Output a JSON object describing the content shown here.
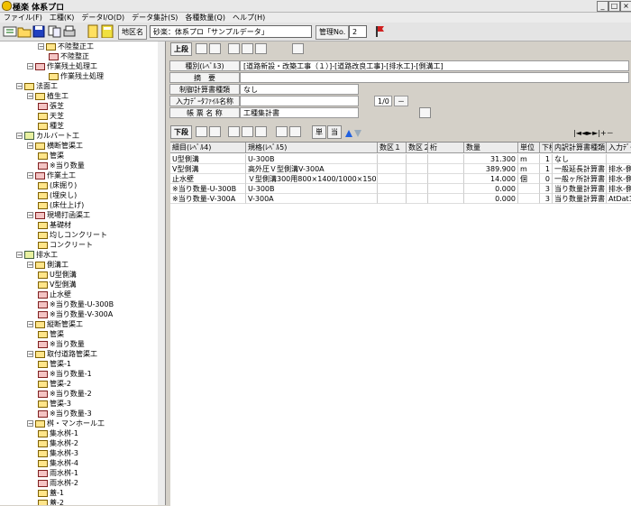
{
  "window": {
    "title": "極楽 体系プロ"
  },
  "menu": [
    "ファイル(F)",
    "工種(K)",
    "データI/O(D)",
    "データ集計(S)",
    "各種数量(Q)",
    "ヘルプ(H)"
  ],
  "toolbar": {
    "area_label": "地区名",
    "area_value": "砂楽：体系プロ「サンプルデータ」",
    "manage_label": "管理No.",
    "manage_value": "2"
  },
  "upper": {
    "title": "上段",
    "type_label": "種別(ﾚﾍﾞﾙ3)",
    "type_value": "[道路新設・改築工事（１）]-[道路改良工事]-[排水工]-[側溝工]",
    "summary_label": "摘　要",
    "summary_value": "",
    "control_label": "制御計算書種類",
    "control_value": "なし",
    "input_file_label": "入力ﾃﾞｰﾀﾌｧｲﾙ名称",
    "input_file_value": "1/0",
    "input_file_dash": "－",
    "book_label": "帳 票 名 称",
    "book_value": "工種集計書"
  },
  "lower": {
    "title": "下段",
    "single_label": "単",
    "per_label": "当",
    "nav": [
      "|◄",
      "◄",
      "►",
      "►|",
      "+",
      "－"
    ]
  },
  "grid": {
    "columns": [
      "細目(ﾚﾍﾞﾙ4)",
      "規格(ﾚﾍﾞﾙ5)",
      "数区１",
      "数区２",
      "桁",
      "数量",
      "単位",
      "下桁",
      "内訳計算書種類",
      "入力ﾃﾞｰﾀ"
    ],
    "rows": [
      [
        "U型側溝",
        "U-300B",
        "",
        "",
        "",
        "31.300",
        "m",
        "1",
        "なし",
        ""
      ],
      [
        "V型側溝",
        "高外圧Ｖ型側溝V-300A",
        "",
        "",
        "",
        "389.900",
        "m",
        "1",
        "一般延長計算書（m）",
        "排水-側溝"
      ],
      [
        "止水壁",
        "Ｖ型側溝300用800×1400/1000×150",
        "",
        "",
        "",
        "14.000",
        "個",
        "0",
        "一般ヶ所計算書（ヶ所）",
        "排水-側溝"
      ],
      [
        "※当り数量-U-300B",
        "U-300B",
        "",
        "",
        "",
        "0.000",
        "",
        "3",
        "当り数量計算書",
        "排水-側溝"
      ],
      [
        "※当り数量-V-300A",
        "V-300A",
        "",
        "",
        "",
        "0.000",
        "",
        "3",
        "当り数量計算書",
        "AtDat1.E"
      ]
    ]
  },
  "tree": [
    {
      "label": "不陸整正工",
      "depth": 2,
      "type": "folder",
      "exp": "−"
    },
    {
      "label": "不陸整正",
      "depth": 3,
      "type": "pfolder"
    },
    {
      "label": "作業残土処理工",
      "depth": 1,
      "type": "pfolder",
      "exp": "−"
    },
    {
      "label": "作業残土処理",
      "depth": 3,
      "type": "folder"
    },
    {
      "label": "法面工",
      "depth": 0,
      "type": "folder",
      "exp": "−"
    },
    {
      "label": "植生工",
      "depth": 1,
      "type": "folder",
      "exp": "−"
    },
    {
      "label": "張芝",
      "depth": 2,
      "type": "pfolder"
    },
    {
      "label": "天芝",
      "depth": 2,
      "type": "folder"
    },
    {
      "label": "種芝",
      "depth": 2,
      "type": "folder"
    },
    {
      "label": "カルバート工",
      "depth": 0,
      "type": "dfolder",
      "exp": "−"
    },
    {
      "label": "横断管渠工",
      "depth": 1,
      "type": "folder",
      "exp": "−"
    },
    {
      "label": "管渠",
      "depth": 2,
      "type": "folder"
    },
    {
      "label": "※当り数量",
      "depth": 2,
      "type": "pfolder"
    },
    {
      "label": "作業土工",
      "depth": 1,
      "type": "pfolder",
      "exp": "−"
    },
    {
      "label": "(床掘り)",
      "depth": 2,
      "type": "folder"
    },
    {
      "label": "(埋戻し)",
      "depth": 2,
      "type": "folder"
    },
    {
      "label": "(床仕上げ)",
      "depth": 2,
      "type": "folder"
    },
    {
      "label": "現場打函渠工",
      "depth": 1,
      "type": "pfolder",
      "exp": "−"
    },
    {
      "label": "基礎材",
      "depth": 2,
      "type": "folder"
    },
    {
      "label": "均しコンクリート",
      "depth": 2,
      "type": "folder"
    },
    {
      "label": "コンクリート",
      "depth": 2,
      "type": "folder"
    },
    {
      "label": "排水工",
      "depth": 0,
      "type": "dfolder",
      "exp": "−"
    },
    {
      "label": "側溝工",
      "depth": 1,
      "type": "folder",
      "exp": "−"
    },
    {
      "label": "U型側溝",
      "depth": 2,
      "type": "folder"
    },
    {
      "label": "V型側溝",
      "depth": 2,
      "type": "folder"
    },
    {
      "label": "止水壁",
      "depth": 2,
      "type": "pfolder"
    },
    {
      "label": "※当り数量-U-300B",
      "depth": 2,
      "type": "pfolder"
    },
    {
      "label": "※当り数量-V-300A",
      "depth": 2,
      "type": "pfolder"
    },
    {
      "label": "縦断管渠工",
      "depth": 1,
      "type": "folder",
      "exp": "−"
    },
    {
      "label": "管渠",
      "depth": 2,
      "type": "folder"
    },
    {
      "label": "※当り数量",
      "depth": 2,
      "type": "pfolder"
    },
    {
      "label": "取付道路管渠工",
      "depth": 1,
      "type": "folder",
      "exp": "−"
    },
    {
      "label": "管渠-1",
      "depth": 2,
      "type": "folder"
    },
    {
      "label": "※当り数量-1",
      "depth": 2,
      "type": "pfolder"
    },
    {
      "label": "管渠-2",
      "depth": 2,
      "type": "folder"
    },
    {
      "label": "※当り数量-2",
      "depth": 2,
      "type": "pfolder"
    },
    {
      "label": "管渠-3",
      "depth": 2,
      "type": "folder"
    },
    {
      "label": "※当り数量-3",
      "depth": 2,
      "type": "pfolder"
    },
    {
      "label": "桝・マンホール工",
      "depth": 1,
      "type": "folder",
      "exp": "−"
    },
    {
      "label": "集水桝-1",
      "depth": 2,
      "type": "folder"
    },
    {
      "label": "集水桝-2",
      "depth": 2,
      "type": "folder"
    },
    {
      "label": "集水桝-3",
      "depth": 2,
      "type": "folder"
    },
    {
      "label": "集水桝-4",
      "depth": 2,
      "type": "folder"
    },
    {
      "label": "雨水桝-1",
      "depth": 2,
      "type": "pfolder"
    },
    {
      "label": "雨水桝-2",
      "depth": 2,
      "type": "pfolder"
    },
    {
      "label": "蓋-1",
      "depth": 2,
      "type": "folder"
    },
    {
      "label": "蓋-2",
      "depth": 2,
      "type": "folder"
    }
  ]
}
